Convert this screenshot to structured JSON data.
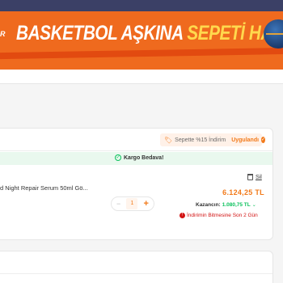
{
  "banner": {
    "cut_text": "R",
    "title_part1": "BASKETBOL AŞKINA ",
    "title_part2": "SEPETİ HAZIRLA"
  },
  "basket": {
    "discount_label": "Sepette %15 İndirim",
    "discount_status": "Uygulandı",
    "shipping_label": "Kargo Bedava!",
    "item": {
      "name": "d Night Repair Serum 50ml Gö...",
      "quantity": "1",
      "price": "6.124,25 TL",
      "earnings_label": "Kazancın:",
      "earnings_value": "1.080,75 TL",
      "expire_text": "İndirimin Bitmesine Son 2 Gün",
      "delete_label": "Sil"
    }
  },
  "colors": {
    "brand": "#f27a1a",
    "banner_bg": "#ef6a1e",
    "success": "#0bc15c",
    "danger": "#d21313"
  },
  "icons": [
    "tag-icon",
    "check-circle-icon",
    "truck-check-icon",
    "trash-icon",
    "minus-icon",
    "plus-icon",
    "chevron-down-icon",
    "clock-icon",
    "basketball-icon"
  ]
}
